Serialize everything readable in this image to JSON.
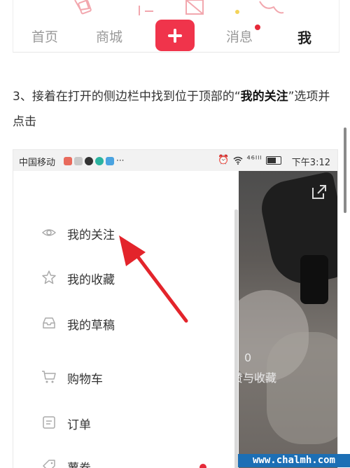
{
  "top_nav": {
    "tabs": [
      "首页",
      "商城",
      "消息",
      "我"
    ],
    "active_tab": "我",
    "plus_icon": "plus-icon",
    "accent_color": "#f0344b"
  },
  "instruction": {
    "prefix": "3、接着在打开的侧边栏中找到位于顶部的“",
    "highlight": "我的关注",
    "suffix": "”选项并点击"
  },
  "status_bar": {
    "carrier": "中国移动",
    "time": "下午3:12",
    "signal_text": "⁴⁶ᴵˡˡ"
  },
  "drawer": {
    "items": [
      {
        "label": "我的关注",
        "icon": "eye-icon"
      },
      {
        "label": "我的收藏",
        "icon": "star-icon"
      },
      {
        "label": "我的草稿",
        "icon": "inbox-icon"
      },
      {
        "label": "购物车",
        "icon": "cart-icon"
      },
      {
        "label": "订单",
        "icon": "order-icon"
      },
      {
        "label": "薯券",
        "icon": "tag-icon"
      }
    ]
  },
  "profile_bg": {
    "count": "0",
    "caption": "赞与收藏"
  },
  "watermark": {
    "text": "www.chalmh.com"
  }
}
